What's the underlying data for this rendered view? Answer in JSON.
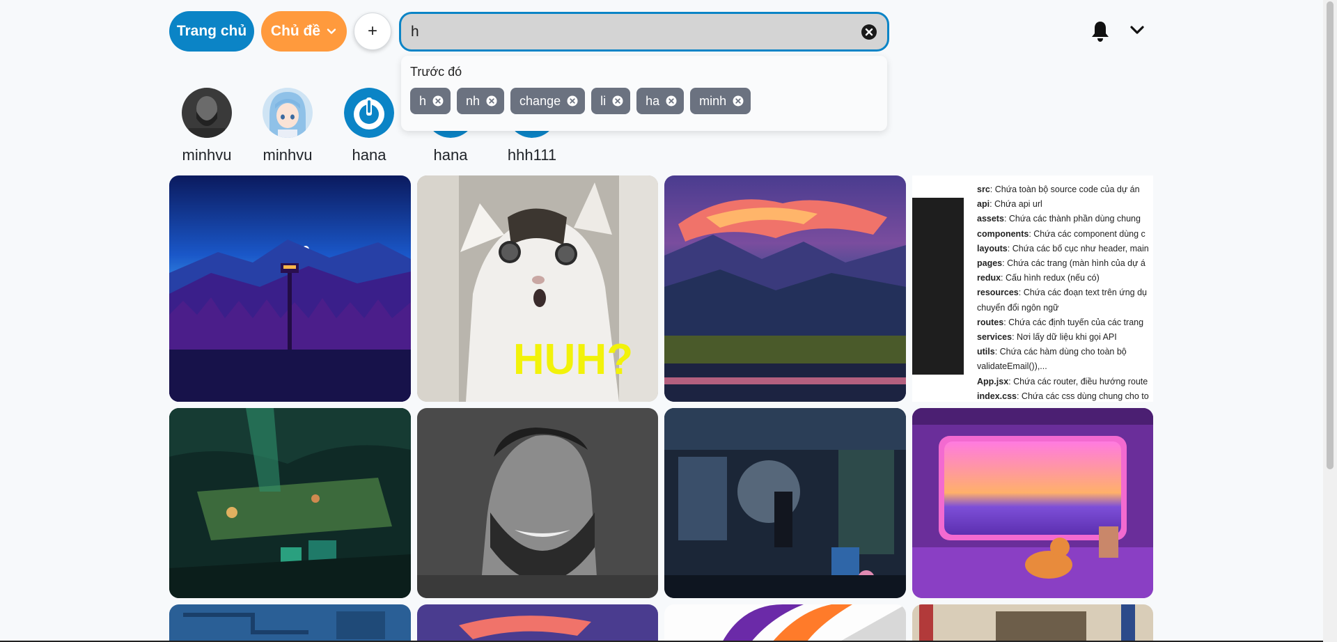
{
  "header": {
    "home_label": "Trang chủ",
    "topic_label": "Chủ đề",
    "add_label": "+",
    "search_value": "h",
    "icons": {
      "topic": "chevron-down-icon",
      "clear": "clear-icon",
      "bell": "bell-icon",
      "menu": "chevron-down-icon"
    }
  },
  "search_history": {
    "title": "Trước đó",
    "items": [
      "h",
      "nh",
      "change",
      "li",
      "ha",
      "minh"
    ]
  },
  "users": [
    {
      "name": "minhvu",
      "avatar": "bearded-man-avatar"
    },
    {
      "name": "minhvu",
      "avatar": "anime-girl-avatar"
    },
    {
      "name": "hana",
      "avatar": "power-icon-avatar"
    },
    {
      "name": "hana",
      "avatar": "power-icon-avatar"
    },
    {
      "name": "hhh111",
      "avatar": "power-icon-avatar"
    }
  ],
  "pins": {
    "meme_text": "HUH?",
    "doc_lines": [
      {
        "key": "src",
        "text": ": Chứa toàn bộ source code của dự án"
      },
      {
        "key": "api",
        "text": ":  Chứa api url"
      },
      {
        "key": "assets",
        "text": ": Chứa các thành phần dùng chung"
      },
      {
        "key": "components",
        "text": ": Chứa các component dùng c"
      },
      {
        "key": "layouts",
        "text": ": Chứa các bố cục như header, main"
      },
      {
        "key": "pages",
        "text": ": Chứa các trang (màn hình của dự á"
      },
      {
        "key": "redux",
        "text": ": Cấu hình redux (nếu có)"
      },
      {
        "key": "resources",
        "text": ": Chứa các đoạn text trên ứng dụ"
      },
      {
        "key": "",
        "text": "chuyển đổi ngôn ngữ"
      },
      {
        "key": "routes",
        "text": ": Chứa các định tuyến của các trang"
      },
      {
        "key": "services",
        "text": ": Nơi lấy dữ liệu khi gọi API"
      },
      {
        "key": "utils",
        "text": ": Chứa các hàm dùng cho toàn bộ"
      },
      {
        "key": "",
        "text": "validateEmail()),..."
      },
      {
        "key": "App.jsx",
        "text": ": Chứa các router, điều hướng route"
      },
      {
        "key": "index.css",
        "text": ": Chứa các css dùng chung cho to"
      }
    ]
  },
  "colors": {
    "primary": "#0b84c6",
    "accent": "#ff9a3d",
    "chip": "#6b7280"
  }
}
